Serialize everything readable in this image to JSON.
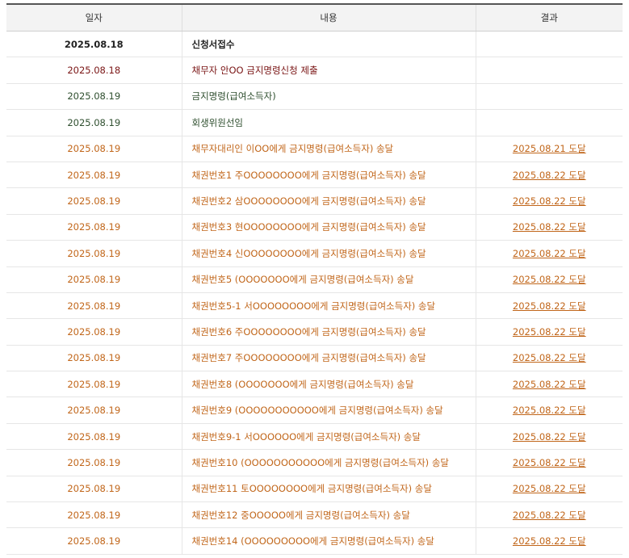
{
  "table": {
    "headers": {
      "date": "일자",
      "content": "내용",
      "result": "결과"
    },
    "rows": [
      {
        "date": "2025.08.18",
        "content": "신청서접수",
        "result": "",
        "tone": "black"
      },
      {
        "date": "2025.08.18",
        "content": "채무자 안OO 금지명령신청 제출",
        "result": "",
        "tone": "red"
      },
      {
        "date": "2025.08.19",
        "content": "금지명령(급여소득자)",
        "result": "",
        "tone": "green"
      },
      {
        "date": "2025.08.19",
        "content": "회생위원선임",
        "result": "",
        "tone": "green"
      },
      {
        "date": "2025.08.19",
        "content": "채무자대리인 이OO에게 금지명령(급여소득자) 송달",
        "result": "2025.08.21 도달",
        "tone": "orange"
      },
      {
        "date": "2025.08.19",
        "content": "채권번호1 주OOOOOOOO에게 금지명령(급여소득자) 송달",
        "result": "2025.08.22 도달",
        "tone": "orange"
      },
      {
        "date": "2025.08.19",
        "content": "채권번호2 삼OOOOOOOO에게 금지명령(급여소득자) 송달",
        "result": "2025.08.22 도달",
        "tone": "orange"
      },
      {
        "date": "2025.08.19",
        "content": "채권번호3 현OOOOOOOO에게 금지명령(급여소득자) 송달",
        "result": "2025.08.22 도달",
        "tone": "orange"
      },
      {
        "date": "2025.08.19",
        "content": "채권번호4 신OOOOOOOO에게 금지명령(급여소득자) 송달",
        "result": "2025.08.22 도달",
        "tone": "orange"
      },
      {
        "date": "2025.08.19",
        "content": "채권번호5 (OOOOOOO에게 금지명령(급여소득자) 송달",
        "result": "2025.08.22 도달",
        "tone": "orange"
      },
      {
        "date": "2025.08.19",
        "content": "채권번호5-1 서OOOOOOOO에게 금지명령(급여소득자) 송달",
        "result": "2025.08.22 도달",
        "tone": "orange"
      },
      {
        "date": "2025.08.19",
        "content": "채권번호6 주OOOOOOOO에게 금지명령(급여소득자) 송달",
        "result": "2025.08.22 도달",
        "tone": "orange"
      },
      {
        "date": "2025.08.19",
        "content": "채권번호7 주OOOOOOOO에게 금지명령(급여소득자) 송달",
        "result": "2025.08.22 도달",
        "tone": "orange"
      },
      {
        "date": "2025.08.19",
        "content": "채권번호8 (OOOOOOO에게 금지명령(급여소득자) 송달",
        "result": "2025.08.22 도달",
        "tone": "orange"
      },
      {
        "date": "2025.08.19",
        "content": "채권번호9 (OOOOOOOOOOO에게 금지명령(급여소득자) 송달",
        "result": "2025.08.22 도달",
        "tone": "orange"
      },
      {
        "date": "2025.08.19",
        "content": "채권번호9-1 서OOOOOO에게 금지명령(급여소득자) 송달",
        "result": "2025.08.22 도달",
        "tone": "orange"
      },
      {
        "date": "2025.08.19",
        "content": "채권번호10 (OOOOOOOOOOO에게 금지명령(급여소득자) 송달",
        "result": "2025.08.22 도달",
        "tone": "orange"
      },
      {
        "date": "2025.08.19",
        "content": "채권번호11 토OOOOOOOO에게 금지명령(급여소득자) 송달",
        "result": "2025.08.22 도달",
        "tone": "orange"
      },
      {
        "date": "2025.08.19",
        "content": "채권번호12 중OOOOO에게 금지명령(급여소득자) 송달",
        "result": "2025.08.22 도달",
        "tone": "orange"
      },
      {
        "date": "2025.08.19",
        "content": "채권번호14 (OOOOOOOOO에게 금지명령(급여소득자) 송달",
        "result": "2025.08.22 도달",
        "tone": "orange"
      }
    ]
  },
  "colors": {
    "black": "#222222",
    "red": "#7a1515",
    "green": "#2f4f2f",
    "orange": "#c1661a",
    "header_bg": "#f3f3f3",
    "header_top_border": "#555555"
  }
}
